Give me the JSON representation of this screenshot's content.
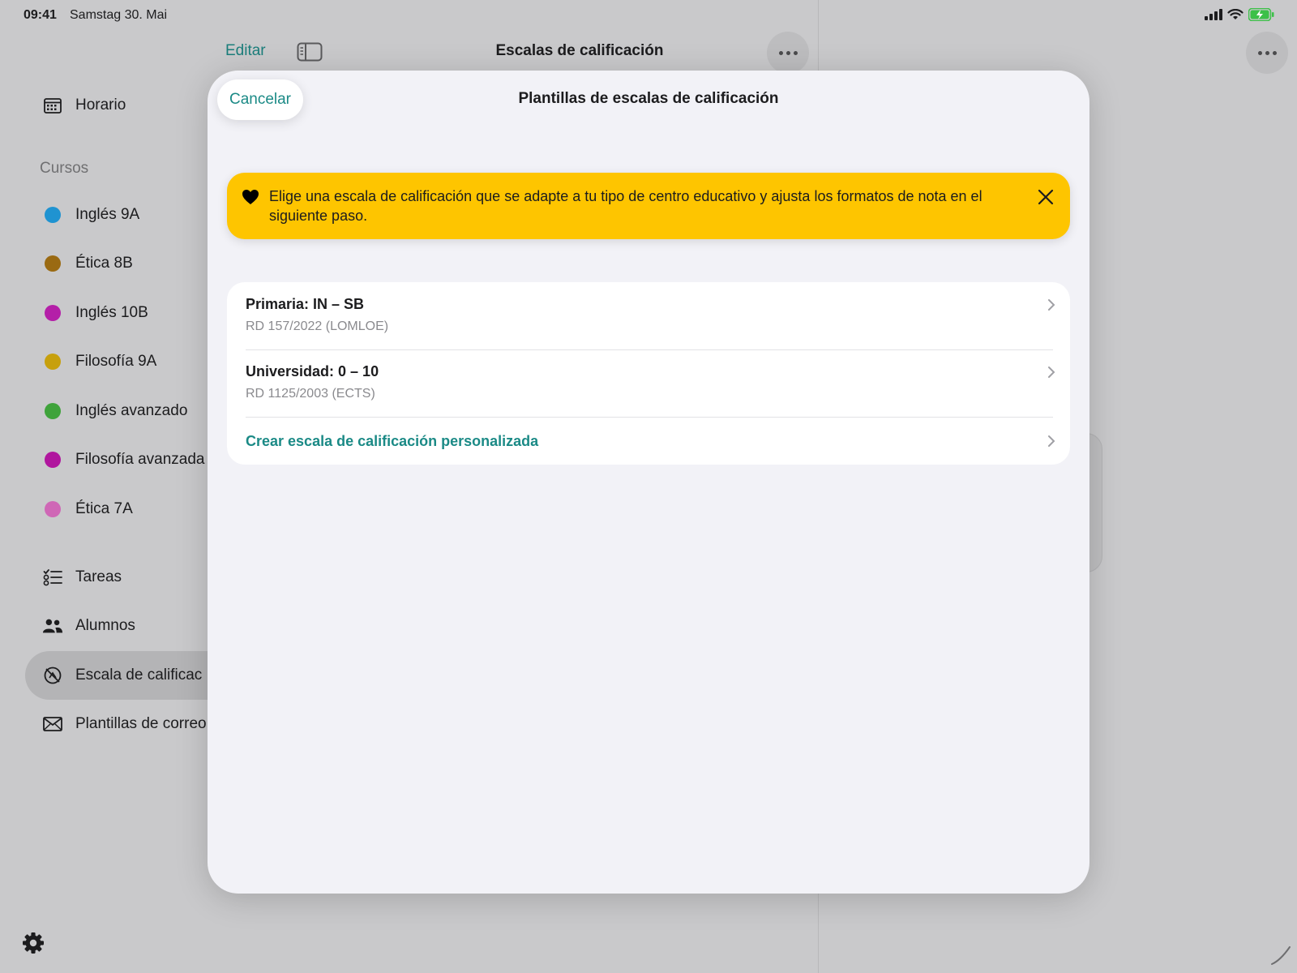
{
  "status_bar": {
    "time": "09:41",
    "date": "Samstag 30. Mai"
  },
  "header": {
    "edit_label": "Editar",
    "title": "Escalas de calificación"
  },
  "sidebar": {
    "top_item": "Horario",
    "section_label": "Cursos",
    "courses": [
      {
        "label": "Inglés 9A",
        "color": "#1f93d1"
      },
      {
        "label": "Ética 8B",
        "color": "#9a6a12"
      },
      {
        "label": "Inglés 10B",
        "color": "#b41fa8"
      },
      {
        "label": "Filosofía 9A",
        "color": "#c7a00d"
      },
      {
        "label": "Inglés avanzado",
        "color": "#3fa33b"
      },
      {
        "label": "Filosofía avanzada",
        "color": "#b0169e"
      },
      {
        "label": "Ética 7A",
        "color": "#cf67b6"
      }
    ],
    "items": [
      {
        "label": "Tareas",
        "icon": "checklist-icon"
      },
      {
        "label": "Alumnos",
        "icon": "people-icon"
      },
      {
        "label": "Escala de calificac",
        "icon": "grade-scale-icon",
        "selected": true
      },
      {
        "label": "Plantillas de correo",
        "icon": "envelope-icon"
      }
    ]
  },
  "modal": {
    "cancel_label": "Cancelar",
    "title": "Plantillas de escalas de calificación",
    "banner": {
      "text": "Elige una escala de calificación que se adapte a tu tipo de centro educativo y ajusta los formatos de nota en el siguiente paso.",
      "background": "#fec500"
    },
    "templates": [
      {
        "title": "Primaria: IN – SB",
        "subtitle": "RD 157/2022 (LOMLOE)"
      },
      {
        "title": "Universidad: 0 – 10",
        "subtitle": "RD 1125/2003 (ECTS)"
      }
    ],
    "custom_label": "Crear escala de calificación personalizada"
  },
  "colors": {
    "accent": "#1b8a86"
  }
}
